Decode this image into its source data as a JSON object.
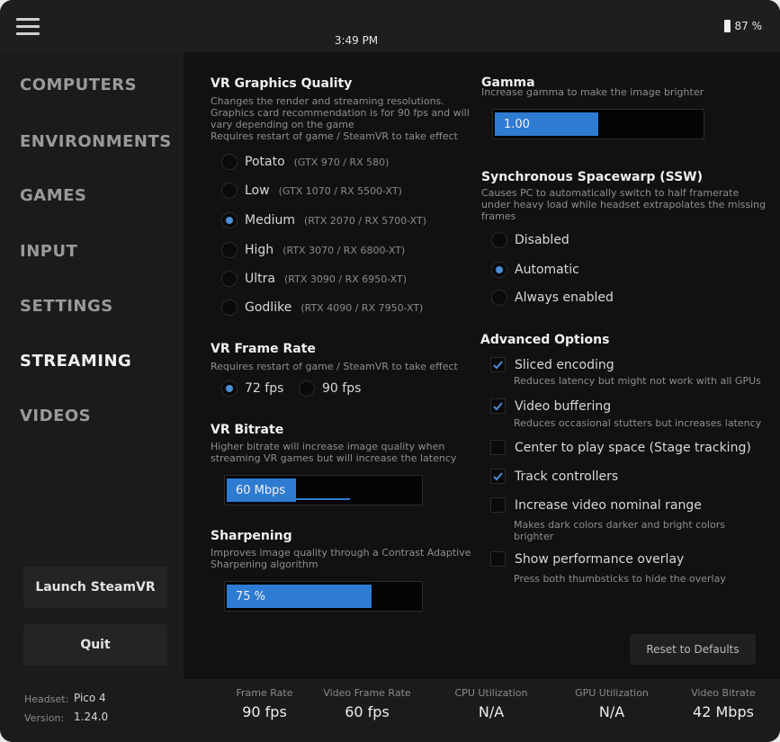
{
  "topbar": {
    "time": "3:49 PM",
    "battery": "87 %"
  },
  "sidebar": {
    "items": [
      {
        "label": "COMPUTERS",
        "active": false
      },
      {
        "label": "ENVIRONMENTS",
        "active": false
      },
      {
        "label": "GAMES",
        "active": false
      },
      {
        "label": "INPUT",
        "active": false
      },
      {
        "label": "SETTINGS",
        "active": false
      },
      {
        "label": "STREAMING",
        "active": true
      },
      {
        "label": "VIDEOS",
        "active": false
      }
    ],
    "launch_label": "Launch SteamVR",
    "quit_label": "Quit"
  },
  "graphics": {
    "title": "VR Graphics Quality",
    "desc_lines": [
      "Changes the render and streaming resolutions.",
      "Graphics card recommendation is for 90 fps and will",
      "vary depending on the game",
      "Requires restart of game / SteamVR to take effect"
    ],
    "options": [
      {
        "label": "Potato",
        "hint": "(GTX 970 / RX 580)",
        "selected": false
      },
      {
        "label": "Low",
        "hint": "(GTX 1070 / RX 5500-XT)",
        "selected": false
      },
      {
        "label": "Medium",
        "hint": "(RTX 2070 / RX 5700-XT)",
        "selected": true
      },
      {
        "label": "High",
        "hint": "(RTX 3070 / RX 6800-XT)",
        "selected": false
      },
      {
        "label": "Ultra",
        "hint": "(RTX 3090 / RX 6950-XT)",
        "selected": false
      },
      {
        "label": "Godlike",
        "hint": "(RTX 4090 / RX 7950-XT)",
        "selected": false
      }
    ]
  },
  "framerate": {
    "title": "VR Frame Rate",
    "desc": "Requires restart of game / SteamVR to take effect",
    "options": [
      {
        "label": "72 fps",
        "selected": true
      },
      {
        "label": "90 fps",
        "selected": false
      }
    ]
  },
  "bitrate": {
    "title": "VR Bitrate",
    "desc_lines": [
      "Higher bitrate will increase image quality when",
      "streaming VR games but will increase the latency"
    ],
    "value_text": "60 Mbps",
    "fill_fraction": 0.36
  },
  "sharpening": {
    "title": "Sharpening",
    "desc_lines": [
      "Improves image quality through a Contrast Adaptive",
      "Sharpening algorithm"
    ],
    "value_text": "75 %",
    "fill_fraction": 0.75
  },
  "gamma": {
    "title": "Gamma",
    "desc": "Increase gamma to make the image brighter",
    "value_text": "1.00",
    "fill_fraction": 0.5
  },
  "ssw": {
    "title": "Synchronous Spacewarp (SSW)",
    "desc_lines": [
      "Causes PC to automatically switch to half framerate",
      "under heavy load while headset extrapolates the missing",
      "frames"
    ],
    "options": [
      {
        "label": "Disabled",
        "selected": false
      },
      {
        "label": "Automatic",
        "selected": true
      },
      {
        "label": "Always enabled",
        "selected": false
      }
    ]
  },
  "advanced": {
    "title": "Advanced Options",
    "options": [
      {
        "label": "Sliced encoding",
        "checked": true,
        "desc_lines": [
          "Reduces latency but might not work with all GPUs"
        ]
      },
      {
        "label": "Video buffering",
        "checked": true,
        "desc_lines": [
          "Reduces occasional stutters but increases latency"
        ]
      },
      {
        "label": "Center to play space (Stage tracking)",
        "checked": false,
        "desc_lines": []
      },
      {
        "label": "Track controllers",
        "checked": true,
        "desc_lines": []
      },
      {
        "label": "Increase video nominal range",
        "checked": false,
        "desc_lines": [
          "Makes dark colors darker and bright colors",
          "brighter"
        ]
      },
      {
        "label": "Show performance overlay",
        "checked": false,
        "desc_lines": [
          "Press both thumbsticks to hide the overlay"
        ]
      }
    ],
    "reset_label": "Reset to Defaults"
  },
  "footer": {
    "headset_label": "Headset:",
    "headset_value": "Pico 4",
    "version_label": "Version:",
    "version_value": "1.24.0",
    "stats": [
      {
        "label": "Frame Rate",
        "value": "90 fps"
      },
      {
        "label": "Video Frame Rate",
        "value": "60 fps"
      },
      {
        "label": "CPU Utilization",
        "value": "N/A"
      },
      {
        "label": "GPU Utilization",
        "value": "N/A"
      },
      {
        "label": "Video Bitrate",
        "value": "42 Mbps"
      }
    ]
  },
  "colors": {
    "accent": "#2e7bd2",
    "radio_dot": "#4a8fd8",
    "background": "#111111",
    "sidebar": "#1b1b1b"
  }
}
